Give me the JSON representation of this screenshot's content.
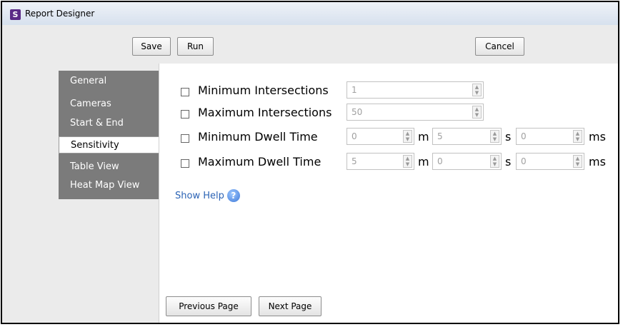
{
  "window": {
    "title": "Report Designer",
    "app_icon_letter": "S"
  },
  "toolbar": {
    "save_label": "Save",
    "run_label": "Run",
    "cancel_label": "Cancel"
  },
  "nav": {
    "items": [
      "General",
      "Cameras",
      "Start & End",
      "Sensitivity",
      "Table View",
      "Heat Map View"
    ],
    "selected": "Sensitivity"
  },
  "sensitivity": {
    "min_intersections": {
      "label": "Minimum Intersections",
      "value": "1"
    },
    "max_intersections": {
      "label": "Maximum Intersections",
      "value": "50"
    },
    "min_dwell": {
      "label": "Minimum Dwell Time",
      "m": "0",
      "s": "5",
      "ms": "0"
    },
    "max_dwell": {
      "label": "Maximum Dwell Time",
      "m": "5",
      "s": "0",
      "ms": "0"
    },
    "units": {
      "m": "m",
      "s": "s",
      "ms": "ms"
    }
  },
  "help": {
    "label": "Show Help",
    "icon": "?"
  },
  "footer": {
    "prev_label": "Previous Page",
    "next_label": "Next Page"
  },
  "colors": {
    "nav_bg": "#7b7b7b",
    "link": "#2b63b5",
    "app_icon": "#5b2a86"
  }
}
